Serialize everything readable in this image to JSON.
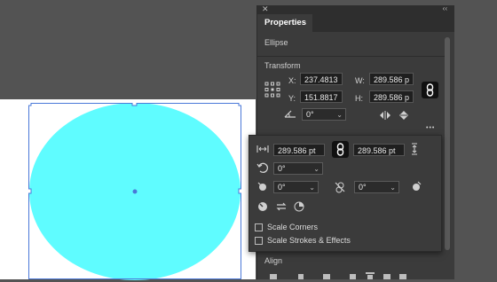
{
  "panel": {
    "close_glyph": "✕",
    "collapse_glyph": "‹‹",
    "tab_label": "Properties",
    "object_type": "Ellipse",
    "transform": {
      "section_label": "Transform",
      "x_label": "X:",
      "x_value": "237.4813",
      "y_label": "Y:",
      "y_value": "151.8817",
      "w_label": "W:",
      "w_value": "289.586 p",
      "h_label": "H:",
      "h_value": "289.586 p",
      "rotate_value": "0°",
      "more_glyph": "•••"
    },
    "align": {
      "section_label": "Align"
    }
  },
  "popup": {
    "width_value": "289.586 pt",
    "height_value": "289.586 pt",
    "rotate_value": "0°",
    "shear_value": "0°",
    "shear2_value": "0°",
    "scale_corners_label": "Scale Corners",
    "scale_strokes_label": "Scale Strokes & Effects"
  },
  "colors": {
    "ellipse_fill": "#5ffcff",
    "selection": "#4a78d8",
    "canvas": "#ffffff",
    "workspace": "#535353"
  },
  "icons": [
    "reference-point-icon",
    "link-icon",
    "rotate-icon",
    "flip-horizontal-icon",
    "flip-vertical-icon",
    "more-icon",
    "width-icon",
    "height-icon",
    "shear-icon",
    "chevron-down-icon"
  ]
}
